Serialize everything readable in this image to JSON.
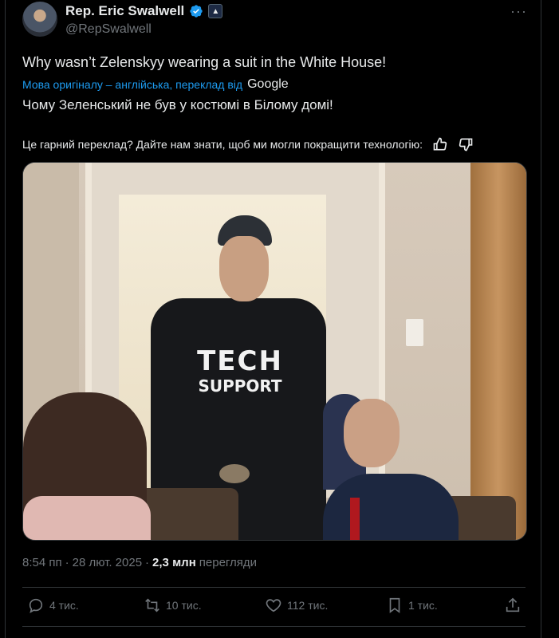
{
  "author": {
    "display_name": "Rep. Eric Swalwell",
    "handle": "@RepSwalwell"
  },
  "tweet": {
    "text": "Why wasn’t Zelenskyy wearing a suit in the White House!",
    "translation_note": "Мова оригіналу – англійська, переклад від",
    "translation_provider": "Google",
    "translated_text": "Чому Зеленський не був у костюмі в Білому домі!",
    "feedback_prompt": "Це гарний переклад? Дайте нам знати, щоб ми могли покращити технологію:"
  },
  "photo": {
    "shirt_line1": "TECH",
    "shirt_line2": "SUPPORT"
  },
  "meta": {
    "time": "8:54 пп",
    "separator1": "·",
    "date": "28 лют. 2025",
    "separator2": "·",
    "views_count": "2,3 млн",
    "views_label": "перегляди"
  },
  "actions": {
    "replies": "4 тис.",
    "reposts": "10 тис.",
    "likes": "112 тис.",
    "bookmarks": "1 тис."
  },
  "icons": {
    "verified": "verified-check-icon",
    "more": "more-icon",
    "thumbs_up": "thumbs-up-icon",
    "thumbs_down": "thumbs-down-icon",
    "reply": "reply-icon",
    "repost": "repost-icon",
    "like": "heart-icon",
    "bookmark": "bookmark-icon",
    "share": "share-icon"
  },
  "colors": {
    "background": "#000000",
    "text": "#e7e9ea",
    "secondary": "#71767b",
    "link": "#1d9bf0",
    "border": "#2f3336"
  }
}
